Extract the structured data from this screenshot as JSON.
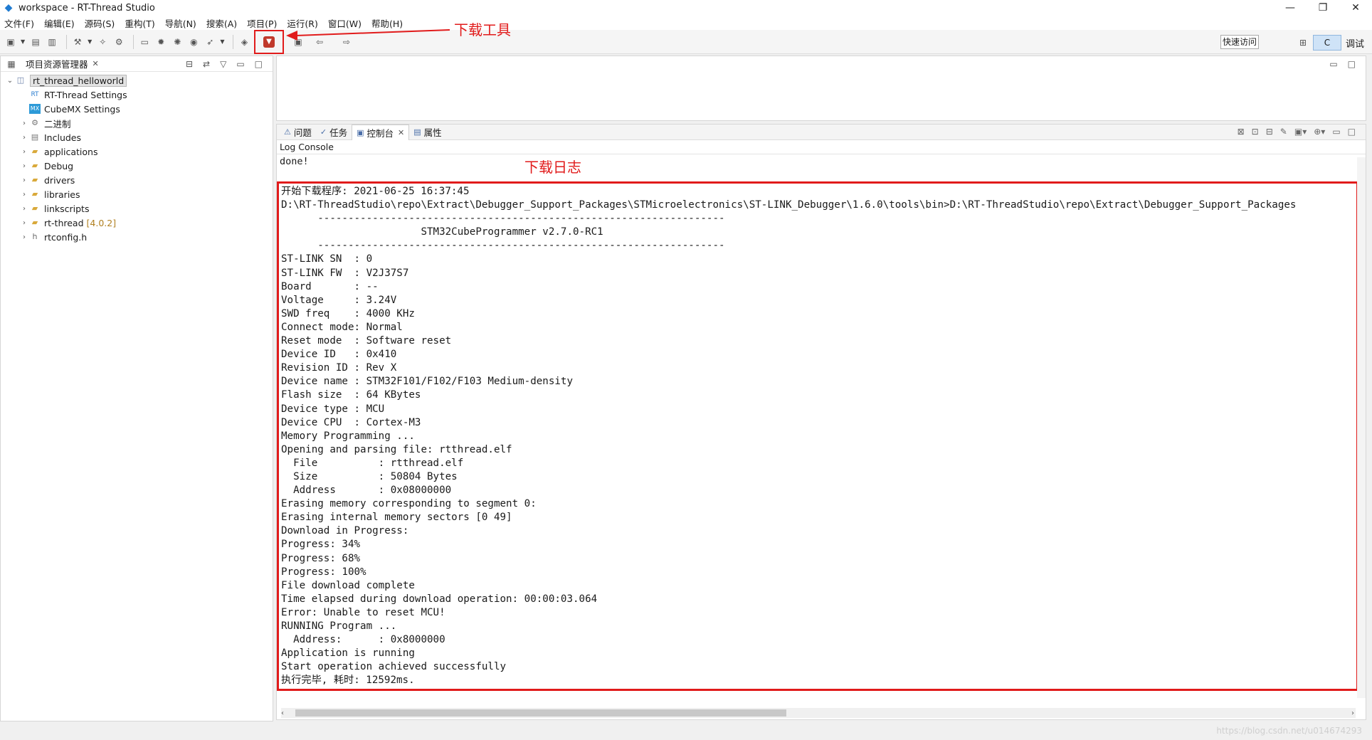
{
  "window": {
    "title": "workspace - RT-Thread Studio",
    "min": "—",
    "max": "❐",
    "close": "✕"
  },
  "menu": [
    "文件(F)",
    "编辑(E)",
    "源码(S)",
    "重构(T)",
    "导航(N)",
    "搜索(A)",
    "项目(P)",
    "运行(R)",
    "窗口(W)",
    "帮助(H)"
  ],
  "toolbar": {
    "quick_access": "快速访问",
    "perspective_c": "C",
    "perspective_debug": "调试"
  },
  "annotations": {
    "download_tool": "下载工具",
    "download_log": "下载日志"
  },
  "project_explorer": {
    "title": "项目资源管理器",
    "items": [
      {
        "label": "rt_thread_helloworld",
        "version": ""
      },
      {
        "label": "RT-Thread Settings",
        "version": ""
      },
      {
        "label": "CubeMX Settings",
        "version": ""
      },
      {
        "label": "二进制",
        "version": ""
      },
      {
        "label": "Includes",
        "version": ""
      },
      {
        "label": "applications",
        "version": ""
      },
      {
        "label": "Debug",
        "version": ""
      },
      {
        "label": "drivers",
        "version": ""
      },
      {
        "label": "libraries",
        "version": ""
      },
      {
        "label": "linkscripts",
        "version": ""
      },
      {
        "label": "rt-thread",
        "version": "[4.0.2]"
      },
      {
        "label": "rtconfig.h",
        "version": ""
      }
    ]
  },
  "console": {
    "tabs": [
      "问题",
      "任务",
      "控制台",
      "属性"
    ],
    "log_title": "Log Console",
    "done_line": "done!",
    "log": [
      "开始下载程序: 2021-06-25 16:37:45",
      "D:\\RT-ThreadStudio\\repo\\Extract\\Debugger_Support_Packages\\STMicroelectronics\\ST-LINK_Debugger\\1.6.0\\tools\\bin>D:\\RT-ThreadStudio\\repo\\Extract\\Debugger_Support_Packages",
      "      -------------------------------------------------------------------",
      "                       STM32CubeProgrammer v2.7.0-RC1",
      "      -------------------------------------------------------------------",
      "ST-LINK SN  : 0",
      "ST-LINK FW  : V2J37S7",
      "Board       : --",
      "Voltage     : 3.24V",
      "SWD freq    : 4000 KHz",
      "Connect mode: Normal",
      "Reset mode  : Software reset",
      "Device ID   : 0x410",
      "Revision ID : Rev X",
      "Device name : STM32F101/F102/F103 Medium-density",
      "Flash size  : 64 KBytes",
      "Device type : MCU",
      "Device CPU  : Cortex-M3",
      "Memory Programming ...",
      "Opening and parsing file: rtthread.elf",
      "  File          : rtthread.elf",
      "  Size          : 50804 Bytes",
      "  Address       : 0x08000000",
      "Erasing memory corresponding to segment 0:",
      "Erasing internal memory sectors [0 49]",
      "Download in Progress:",
      "Progress: 34%",
      "Progress: 68%",
      "Progress: 100%",
      "File download complete",
      "Time elapsed during download operation: 00:00:03.064",
      "Error: Unable to reset MCU!",
      "RUNNING Program ...",
      "  Address:      : 0x8000000",
      "Application is running",
      "Start operation achieved successfully",
      "执行完毕, 耗时: 12592ms."
    ]
  },
  "watermark": "https://blog.csdn.net/u014674293",
  "colors": {
    "annotation": "#e11b1b"
  }
}
